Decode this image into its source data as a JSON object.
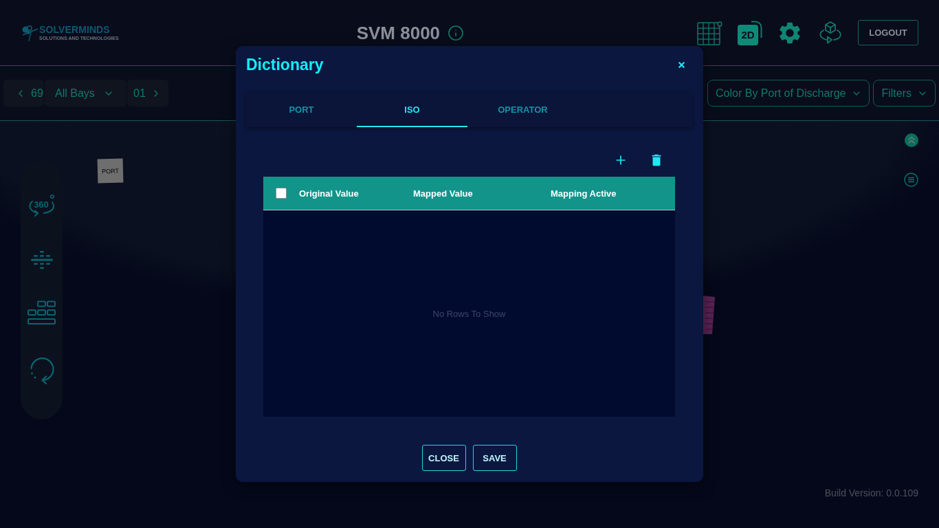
{
  "header": {
    "logo": {
      "name": "SOLVERMINDS",
      "tagline": "SOLUTIONS AND TECHNOLOGIES"
    },
    "title": "SVM 8000",
    "view_2d": "2D",
    "logout": "LOGOUT"
  },
  "toolbar": {
    "bay_nav": {
      "previous": "69",
      "bay": "All Bays",
      "next": "01"
    },
    "color_by": "Color By Port of Discharge",
    "filters": "Filters"
  },
  "scene": {
    "rotate_label": "360",
    "port_label": "PORT",
    "build_version": "Build Version: 0.0.109"
  },
  "dialog": {
    "title": "Dictionary",
    "tabs": [
      {
        "label": "PORT",
        "selected": false
      },
      {
        "label": "ISO",
        "selected": true
      },
      {
        "label": "OPERATOR",
        "selected": false
      }
    ],
    "table": {
      "select_all": {
        "checked": false
      },
      "columns": [
        "Original Value",
        "Mapped Value",
        "Mapping Active"
      ],
      "empty_message": "No Rows To Show"
    },
    "buttons": [
      "CLOSE",
      "SAVE"
    ]
  }
}
